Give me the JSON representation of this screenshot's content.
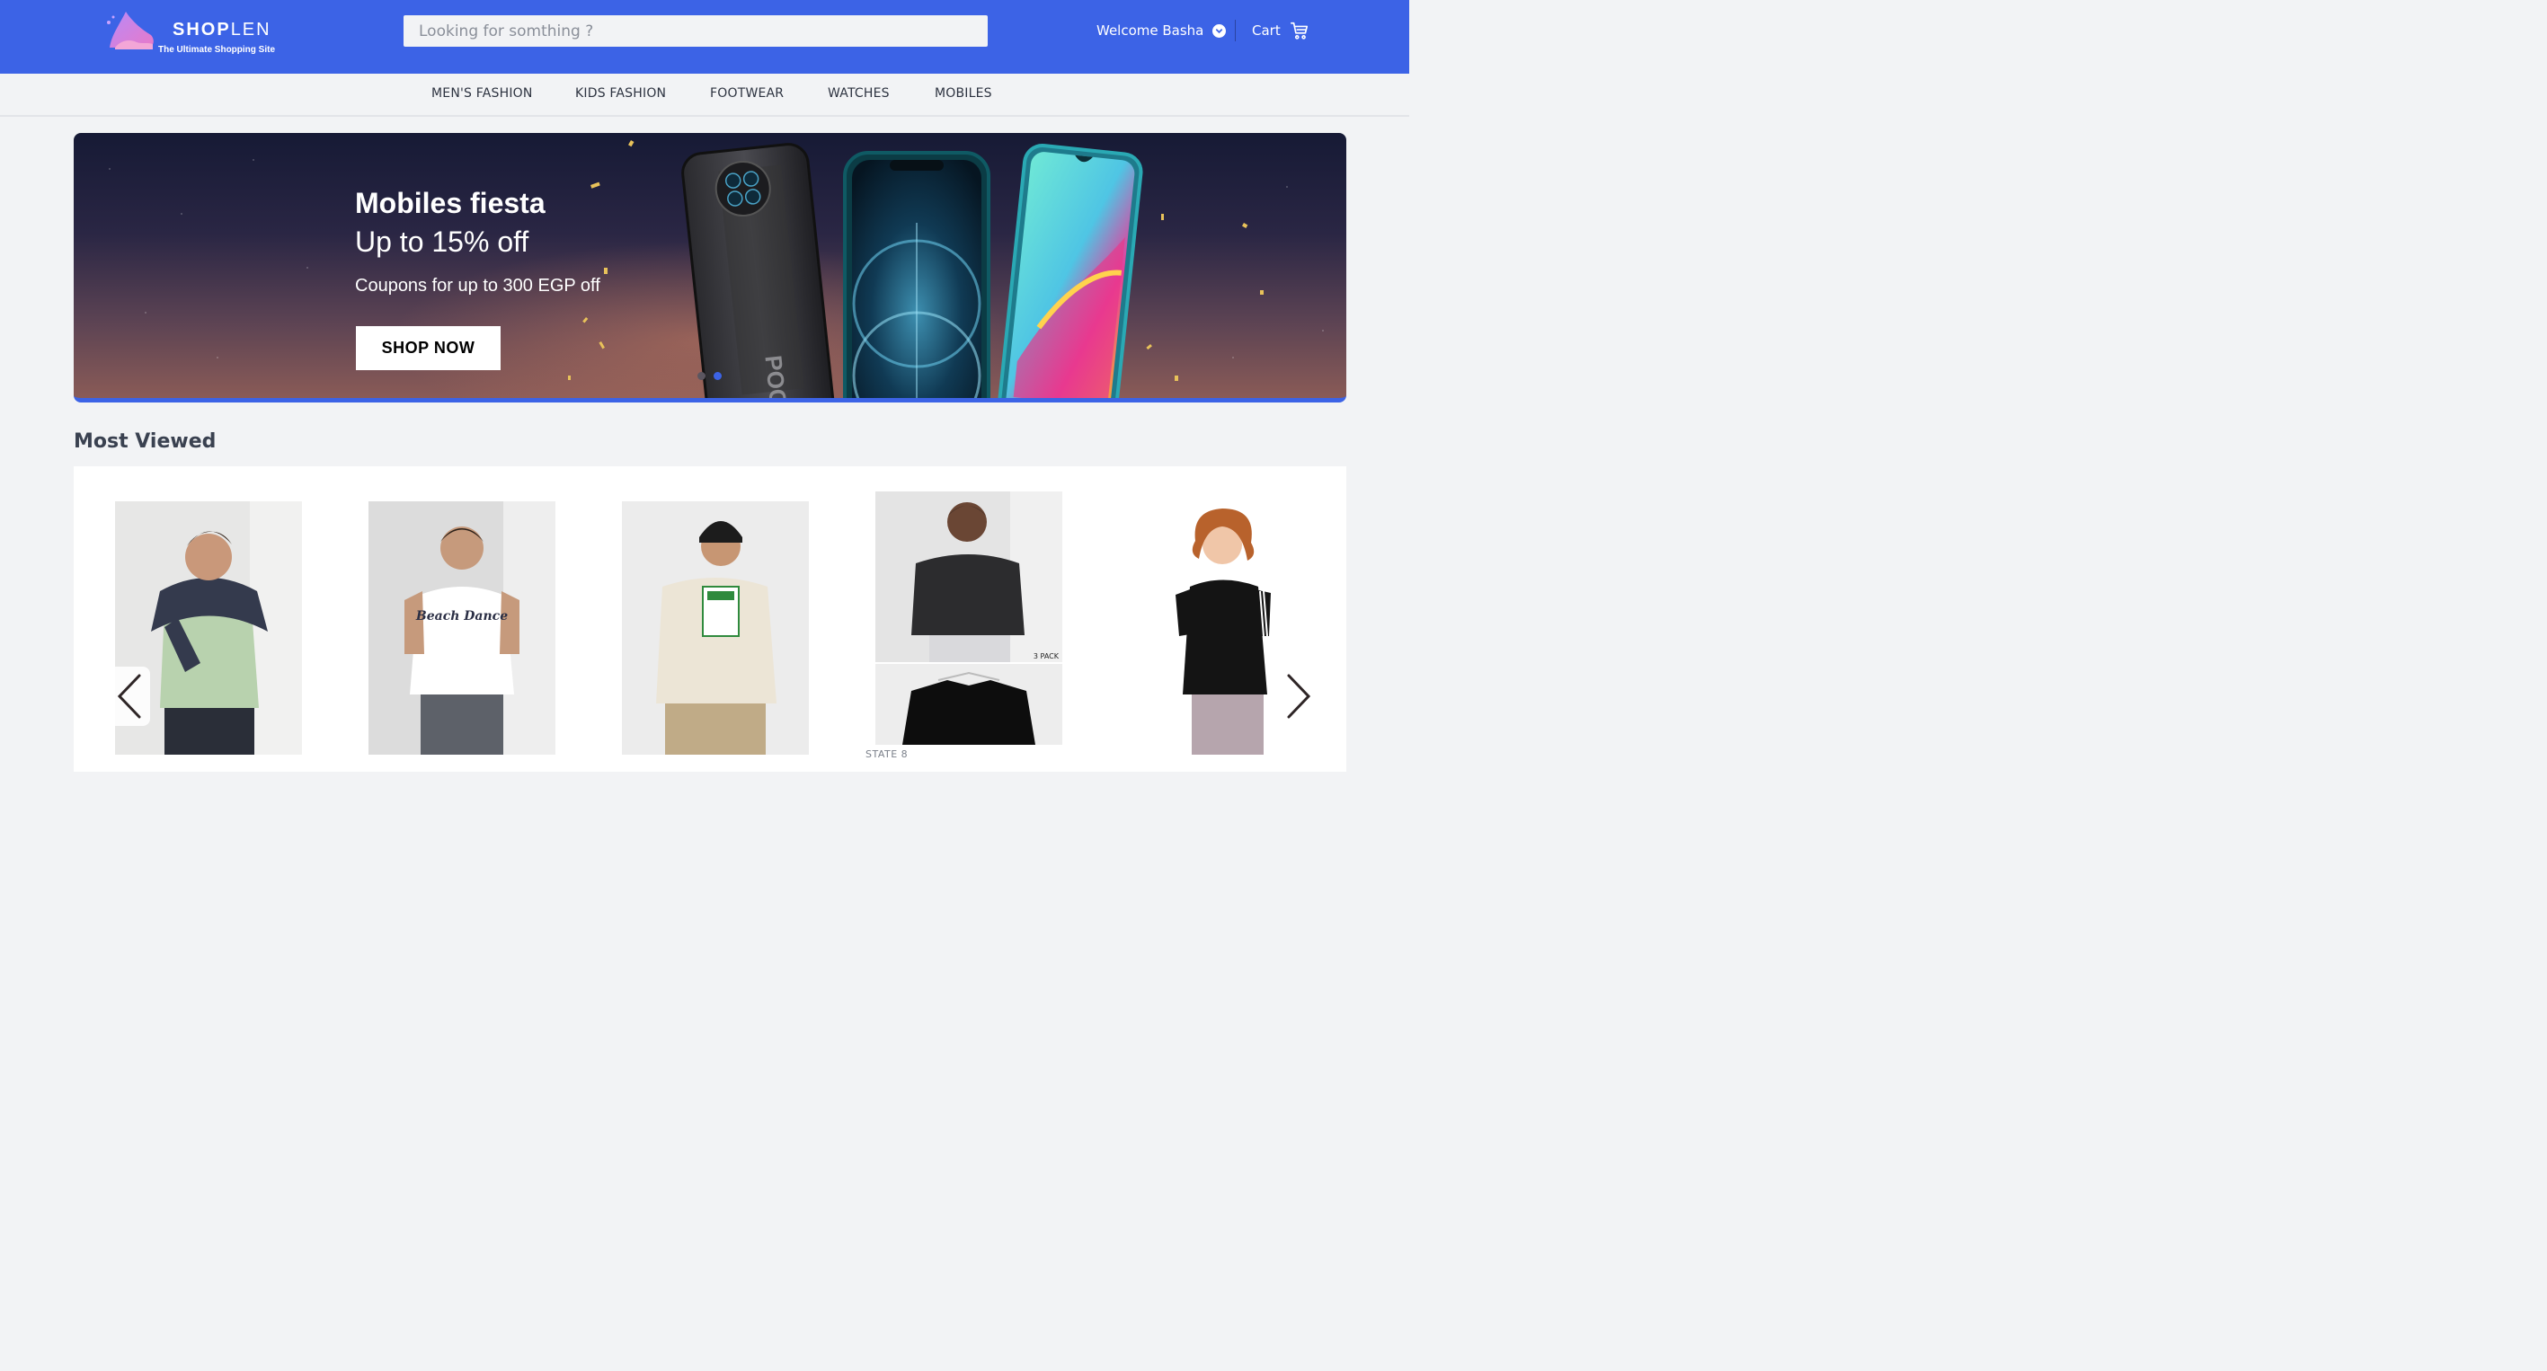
{
  "header": {
    "logo": {
      "name_bold": "SHOP",
      "name_light": "LEN",
      "tagline": "The Ultimate Shopping Site"
    },
    "search": {
      "placeholder": "Looking for somthing ?",
      "value": ""
    },
    "user": {
      "greeting": "Welcome Basha"
    },
    "cart": {
      "label": "Cart"
    }
  },
  "categories": [
    {
      "label": "MEN'S FASHION"
    },
    {
      "label": "KIDS FASHION"
    },
    {
      "label": "FOOTWEAR"
    },
    {
      "label": "WATCHES"
    },
    {
      "label": "MOBILES"
    }
  ],
  "banner": {
    "title": "Mobiles fiesta",
    "subtitle": "Up to 15% off",
    "coupon": "Coupons for up to 300 EGP off",
    "cta": "SHOP NOW",
    "phone_brand": "POCO",
    "slides_total": 2,
    "active_slide": 2
  },
  "most_viewed": {
    "title": "Most Viewed",
    "products": [
      {
        "image": "man-green-tshirt-navy-sweater"
      },
      {
        "image": "man-white-graphic-tshirt"
      },
      {
        "image": "man-cream-tshirt-adidas-print"
      },
      {
        "image": "man-black-tshirt-3-pack",
        "badge": "3 PACK",
        "brand": "STATE 8"
      },
      {
        "image": "man-black-adidas-tshirt"
      }
    ]
  },
  "colors": {
    "primary": "#3c63e6",
    "background": "#f2f3f5",
    "text": "#2d3340"
  }
}
